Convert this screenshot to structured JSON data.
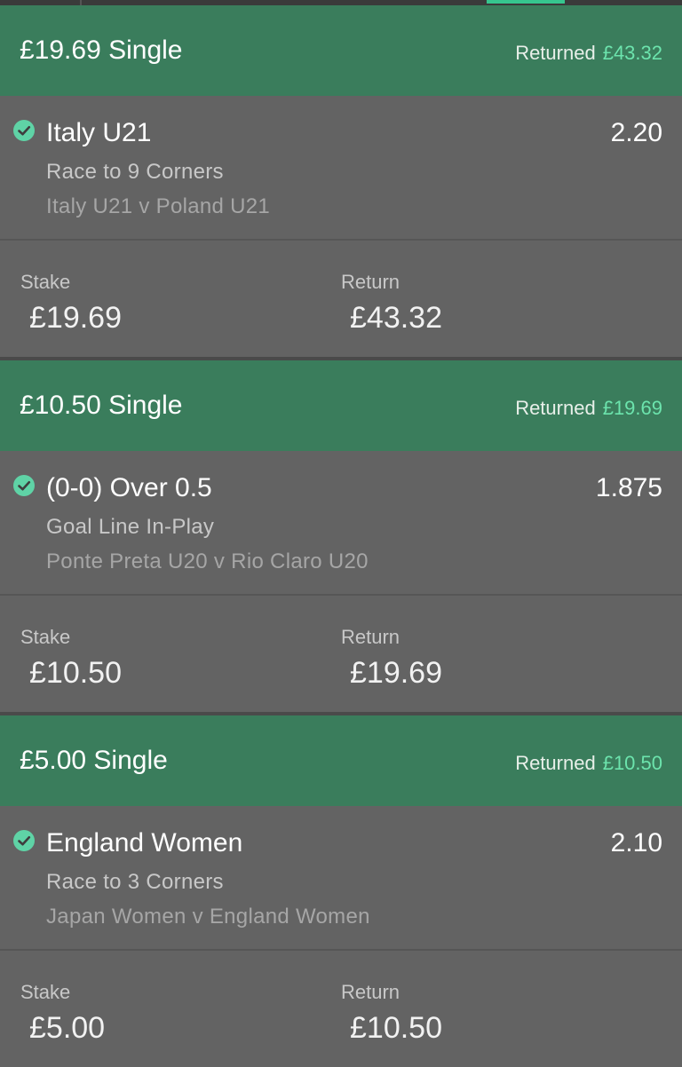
{
  "colors": {
    "header_green": "#3a7d5c",
    "returned_amount_green": "#6ce4ad",
    "check_green": "#5fd3a6",
    "body_grey": "#636363"
  },
  "icons": {
    "check": "check-circle-icon"
  },
  "bets": [
    {
      "title": "£19.69 Single",
      "returned_label": "Returned",
      "returned_amount": "£43.32",
      "selection": "Italy U21",
      "odds": "2.20",
      "market": "Race to 9 Corners",
      "event": "Italy U21 v Poland U21",
      "stake_label": "Stake",
      "stake_value": "£19.69",
      "return_label": "Return",
      "return_value": "£43.32"
    },
    {
      "title": "£10.50 Single",
      "returned_label": "Returned",
      "returned_amount": "£19.69",
      "selection": "(0-0) Over 0.5",
      "odds": "1.875",
      "market": "Goal Line In-Play",
      "event": "Ponte Preta U20 v Rio Claro U20",
      "stake_label": "Stake",
      "stake_value": "£10.50",
      "return_label": "Return",
      "return_value": "£19.69"
    },
    {
      "title": "£5.00 Single",
      "returned_label": "Returned",
      "returned_amount": "£10.50",
      "selection": "England Women",
      "odds": "2.10",
      "market": "Race to 3 Corners",
      "event": "Japan Women v England Women",
      "stake_label": "Stake",
      "stake_value": "£5.00",
      "return_label": "Return",
      "return_value": "£10.50"
    }
  ]
}
